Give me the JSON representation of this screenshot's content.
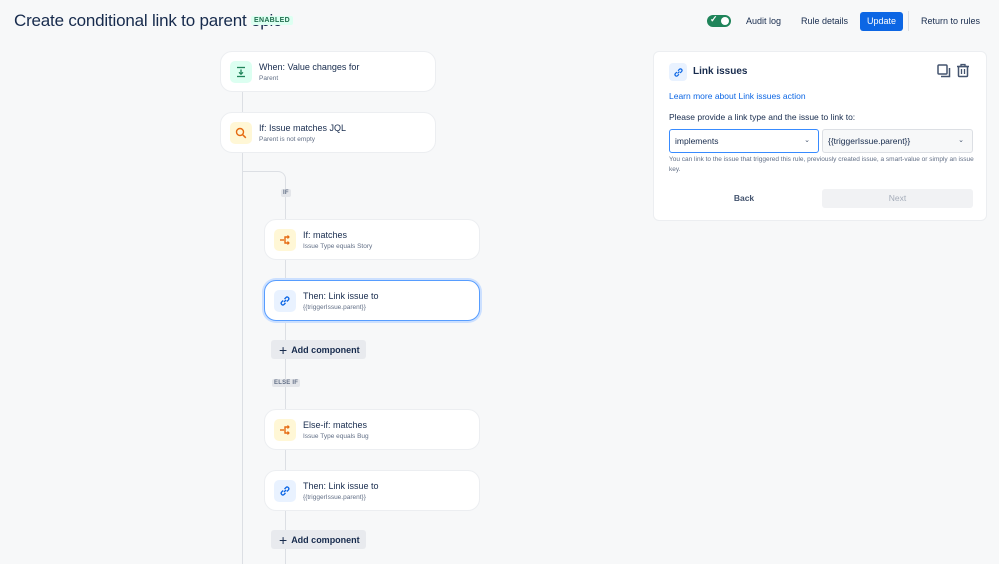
{
  "header": {
    "title": "Create conditional link to parent epic",
    "status_badge": "ENABLED",
    "toggle_on": true,
    "audit_log": "Audit log",
    "rule_details": "Rule details",
    "update": "Update",
    "return_to_rules": "Return to rules"
  },
  "flow": {
    "trigger": {
      "title": "When: Value changes for",
      "subtitle": "Parent",
      "icon": "trigger-icon"
    },
    "condition": {
      "title": "If: Issue matches JQL",
      "subtitle": "Parent is not empty",
      "icon": "search-icon"
    },
    "branch_tags": {
      "if": "IF",
      "else_if": "ELSE IF"
    },
    "if_block": {
      "condition": {
        "title": "If: matches",
        "subtitle": "Issue Type equals Story",
        "icon": "branch-icon"
      },
      "action": {
        "title": "Then: Link issue to",
        "subtitle": "{{triggerIssue.parent}}",
        "icon": "link-icon"
      },
      "add_component": "Add component"
    },
    "else_if_block": {
      "condition": {
        "title": "Else-if: matches",
        "subtitle": "Issue Type equals Bug",
        "icon": "branch-icon"
      },
      "action": {
        "title": "Then: Link issue to",
        "subtitle": "{{triggerIssue.parent}}",
        "icon": "link-icon"
      },
      "add_component": "Add component"
    }
  },
  "panel": {
    "title": "Link issues",
    "learn_more": "Learn more about Link issues action",
    "prompt": "Please provide a link type and the issue to link to:",
    "link_type_value": "implements",
    "issue_value": "{{triggerIssue.parent}}",
    "help_text": "You can link to the issue that triggered this rule, previously created issue, a smart-value or simply an issue key.",
    "back": "Back",
    "next": "Next"
  },
  "colors": {
    "primary": "#0c66e4",
    "enabled_green": "#1f845a",
    "selected_border": "#579dff"
  }
}
